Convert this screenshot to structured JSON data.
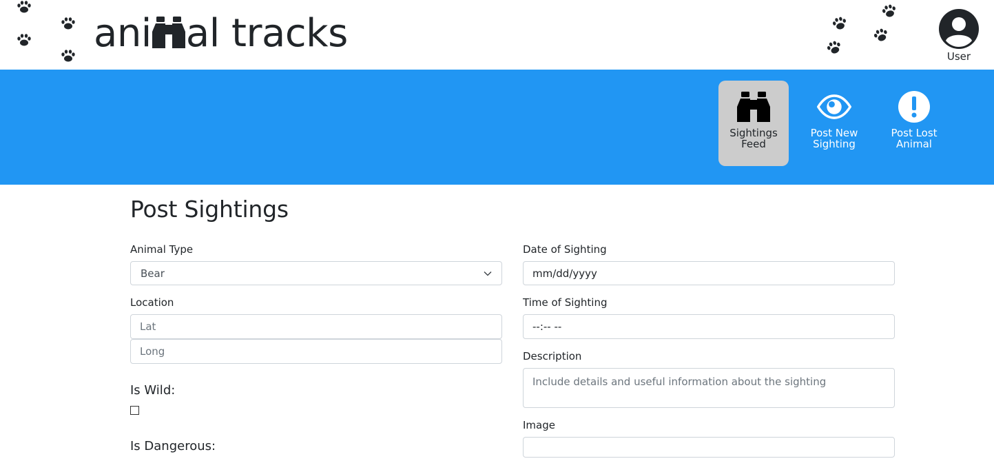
{
  "header": {
    "logo_pre": "ani",
    "logo_post": "al tracks",
    "logo_icon": "binoculars-icon",
    "user_label": "User",
    "user_icon": "user-circle-icon",
    "decoration_icon": "paw-print-icon"
  },
  "nav": {
    "items": [
      {
        "label": "Sightings Feed",
        "icon": "binoculars-icon",
        "active": true
      },
      {
        "label": "Post New Sighting",
        "icon": "eye-icon",
        "active": false
      },
      {
        "label": "Post Lost Animal",
        "icon": "exclamation-circle-icon",
        "active": false
      }
    ]
  },
  "form": {
    "title": "Post Sightings",
    "animal_type": {
      "label": "Animal Type",
      "value": "Bear"
    },
    "location": {
      "label": "Location",
      "lat_placeholder": "Lat",
      "long_placeholder": "Long"
    },
    "is_wild": {
      "label": "Is Wild:",
      "checked": false
    },
    "is_dangerous": {
      "label": "Is Dangerous:"
    },
    "date": {
      "label": "Date of Sighting",
      "value": "mm/dd/yyyy"
    },
    "time": {
      "label": "Time of Sighting",
      "value": "--:-- --"
    },
    "description": {
      "label": "Description",
      "placeholder": "Include details and useful information about the sighting"
    },
    "image": {
      "label": "Image"
    }
  },
  "colors": {
    "navbar": "#2196f3",
    "active_nav": "#cccccc",
    "text": "#212529",
    "border": "#ced4da"
  }
}
